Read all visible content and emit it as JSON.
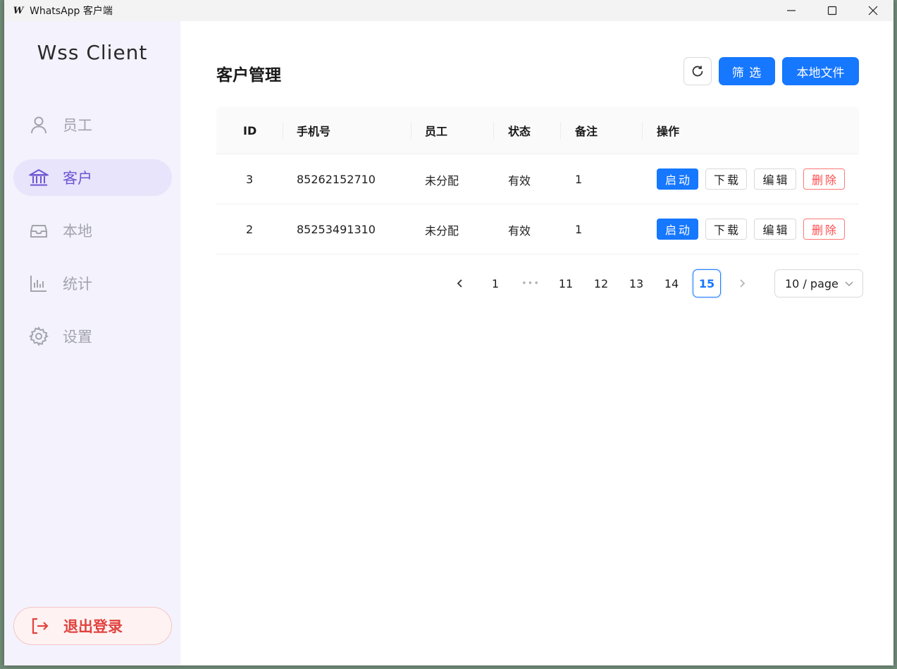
{
  "window": {
    "title": "WhatsApp 客户端",
    "app_icon_letter": "W"
  },
  "sidebar": {
    "brand": "Wss Client",
    "items": [
      {
        "label": "员工",
        "icon": "user-icon",
        "active": false
      },
      {
        "label": "客户",
        "icon": "bank-icon",
        "active": true
      },
      {
        "label": "本地",
        "icon": "inbox-icon",
        "active": false
      },
      {
        "label": "统计",
        "icon": "bar-chart-icon",
        "active": false
      },
      {
        "label": "设置",
        "icon": "gear-icon",
        "active": false
      }
    ],
    "logout_label": "退出登录"
  },
  "main": {
    "title": "客户管理",
    "filter_label": "筛 选",
    "local_file_label": "本地文件",
    "table": {
      "columns": [
        "ID",
        "手机号",
        "员工",
        "状态",
        "备注",
        "操作"
      ],
      "rows": [
        {
          "id": "3",
          "phone": "85262152710",
          "staff": "未分配",
          "status": "有效",
          "note": "1"
        },
        {
          "id": "2",
          "phone": "85253491310",
          "staff": "未分配",
          "status": "有效",
          "note": "1"
        }
      ],
      "actions": {
        "start": "启动",
        "download": "下载",
        "edit": "编辑",
        "delete": "删除"
      }
    },
    "pagination": {
      "pages": [
        "1",
        "11",
        "12",
        "13",
        "14",
        "15"
      ],
      "ellipsis": "•••",
      "current": "15",
      "page_size": "10 / page"
    }
  },
  "colors": {
    "primary": "#1677ff",
    "sidebar_bg": "#f3f2fd",
    "active_nav": "#6d55d2",
    "danger": "#ff4d4f"
  }
}
